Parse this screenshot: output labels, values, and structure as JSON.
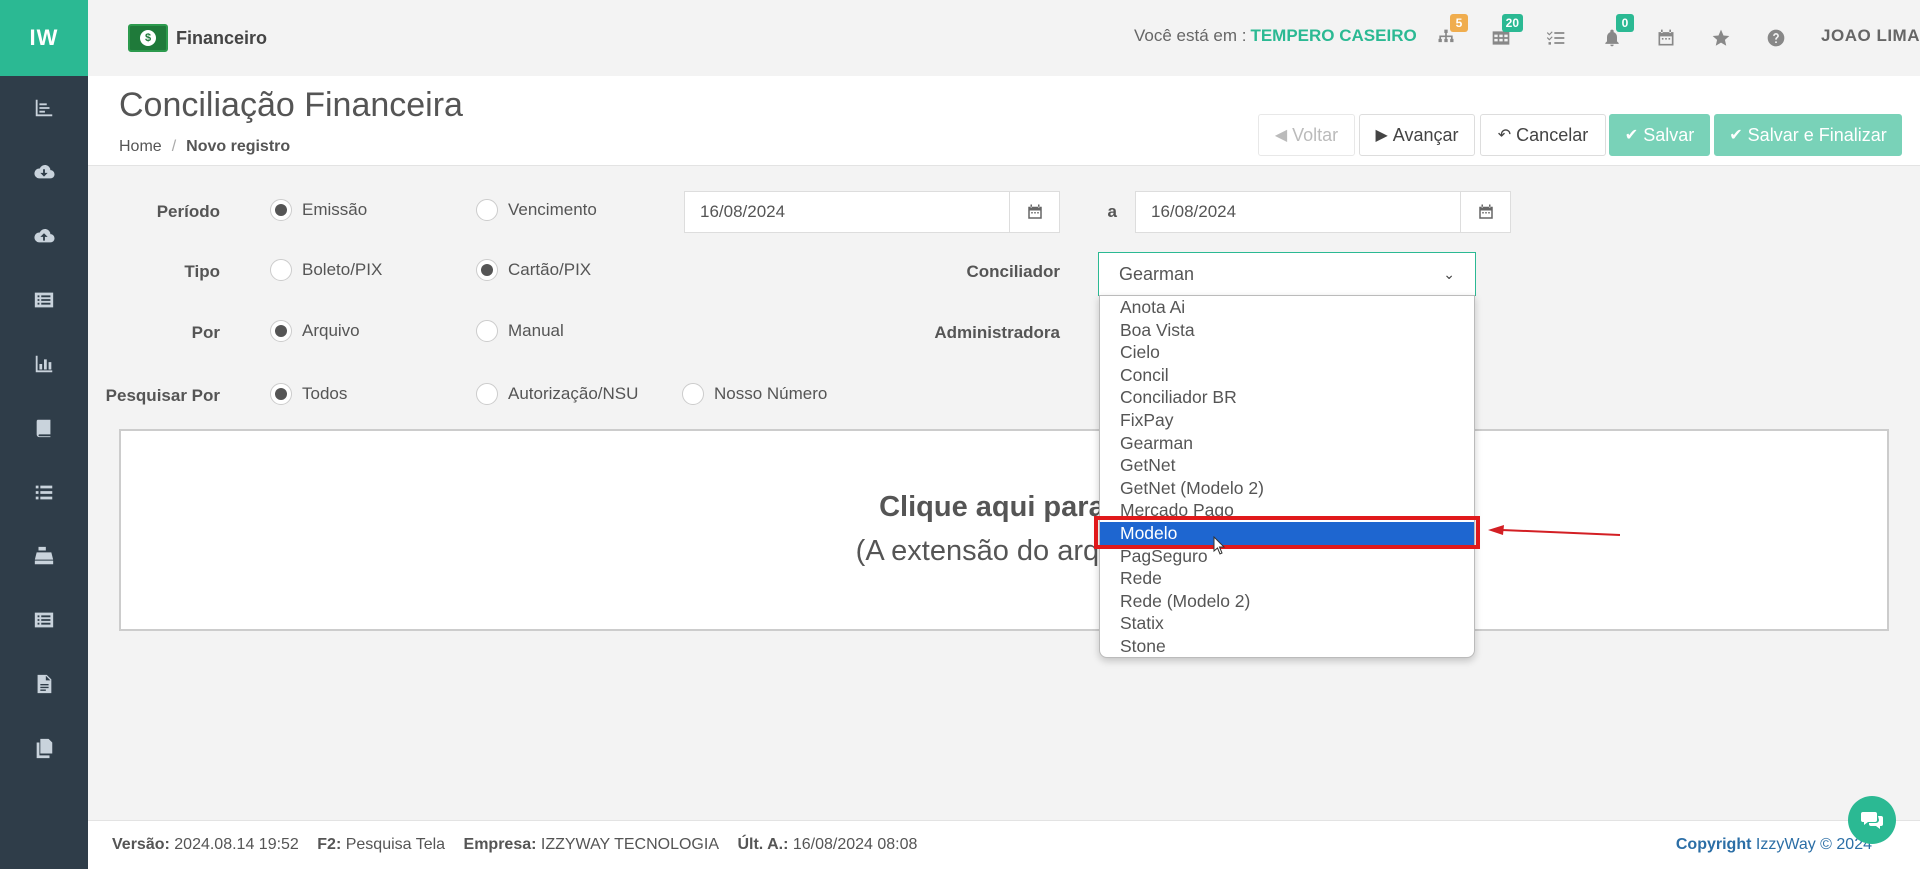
{
  "sidebar": {
    "logo": "IW",
    "items": [
      "chart-icon",
      "cloud-download-icon",
      "cloud-upload-icon",
      "list-alt-icon",
      "bar-chart-icon",
      "book-icon",
      "list-icon",
      "cash-register-icon",
      "list-alt-icon",
      "file-icon",
      "copy-icon"
    ]
  },
  "header": {
    "module": "Financeiro",
    "context_label": "Você está em :",
    "context_value": "TEMPERO CASEIRO",
    "badges": {
      "sitemap": "5",
      "table": "20",
      "bell": "0"
    },
    "badge_colors": {
      "sitemap": "#f0ad4e",
      "table": "#2bb993",
      "bell": "#2bb993"
    },
    "user": "JOAO LIMA"
  },
  "page": {
    "title": "Conciliação Financeira",
    "breadcrumb_home": "Home",
    "breadcrumb_current": "Novo registro"
  },
  "actions": {
    "voltar": "Voltar",
    "avancar": "Avançar",
    "cancelar": "Cancelar",
    "salvar": "Salvar",
    "salvar_finalizar": "Salvar e Finalizar"
  },
  "form": {
    "periodo_label": "Período",
    "periodo_emissao": "Emissão",
    "periodo_vencimento": "Vencimento",
    "data_inicio": "16/08/2024",
    "data_sep": "a",
    "data_fim": "16/08/2024",
    "tipo_label": "Tipo",
    "tipo_boleto": "Boleto/PIX",
    "tipo_cartao": "Cartão/PIX",
    "conciliador_label": "Conciliador",
    "conciliador_value": "Gearman",
    "por_label": "Por",
    "por_arquivo": "Arquivo",
    "por_manual": "Manual",
    "administradora_label": "Administradora",
    "pesquisar_label": "Pesquisar Por",
    "pesquisar_todos": "Todos",
    "pesquisar_autorizacao": "Autorização/NSU",
    "pesquisar_nosso": "Nosso Número"
  },
  "dropzone": {
    "title": "Clique aqui para e",
    "subtitle": "(A extensão do arquivo"
  },
  "dropdown": {
    "options": [
      "Anota Ai",
      "Boa Vista",
      "Cielo",
      "Concil",
      "Conciliador BR",
      "FixPay",
      "Gearman",
      "GetNet",
      "GetNet (Modelo 2)",
      "Mercado Pago",
      "Modelo",
      "PagSeguro",
      "Rede",
      "Rede (Modelo 2)",
      "Statix",
      "Stone"
    ],
    "highlighted": "Modelo"
  },
  "footer": {
    "versao_label": "Versão:",
    "versao": "2024.08.14 19:52",
    "f2_label": "F2:",
    "f2": "Pesquisa Tela",
    "empresa_label": "Empresa:",
    "empresa": "IZZYWAY TECNOLOGIA",
    "ult_label": "Últ. A.:",
    "ult": "16/08/2024 08:08",
    "copyright_label": "Copyright",
    "copyright": "IzzyWay © 2024"
  },
  "colors": {
    "accent": "#2bb993",
    "sidebar": "#2f3d49",
    "selection": "#1e66d0",
    "highlight": "#e0191b"
  }
}
